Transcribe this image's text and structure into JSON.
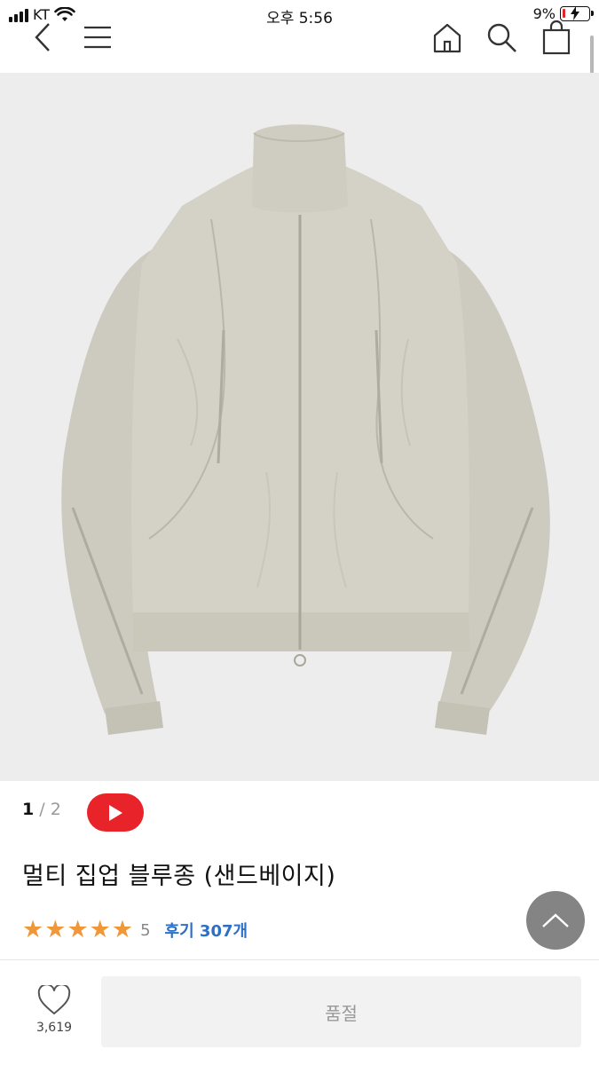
{
  "status_bar": {
    "carrier": "KT",
    "time": "오후 5:56",
    "battery": "9%"
  },
  "nav": {
    "icons": [
      "back-icon",
      "menu-icon",
      "home-icon",
      "search-icon",
      "shopping-bag-icon"
    ]
  },
  "product": {
    "image_counter_current": "1",
    "image_counter_total": "/ 2",
    "title": "멀티 집업 블루종 (샌드베이지)",
    "rating_stars": 5,
    "rating_score": "5",
    "reviews_label": "후기 307개"
  },
  "bottom_bar": {
    "like_count": "3,619",
    "soldout_label": "품절"
  },
  "colors": {
    "accent_blue": "#2c6fc6",
    "star": "#f0973a",
    "video_red": "#e8232a",
    "jacket": "#d4d2c6"
  }
}
